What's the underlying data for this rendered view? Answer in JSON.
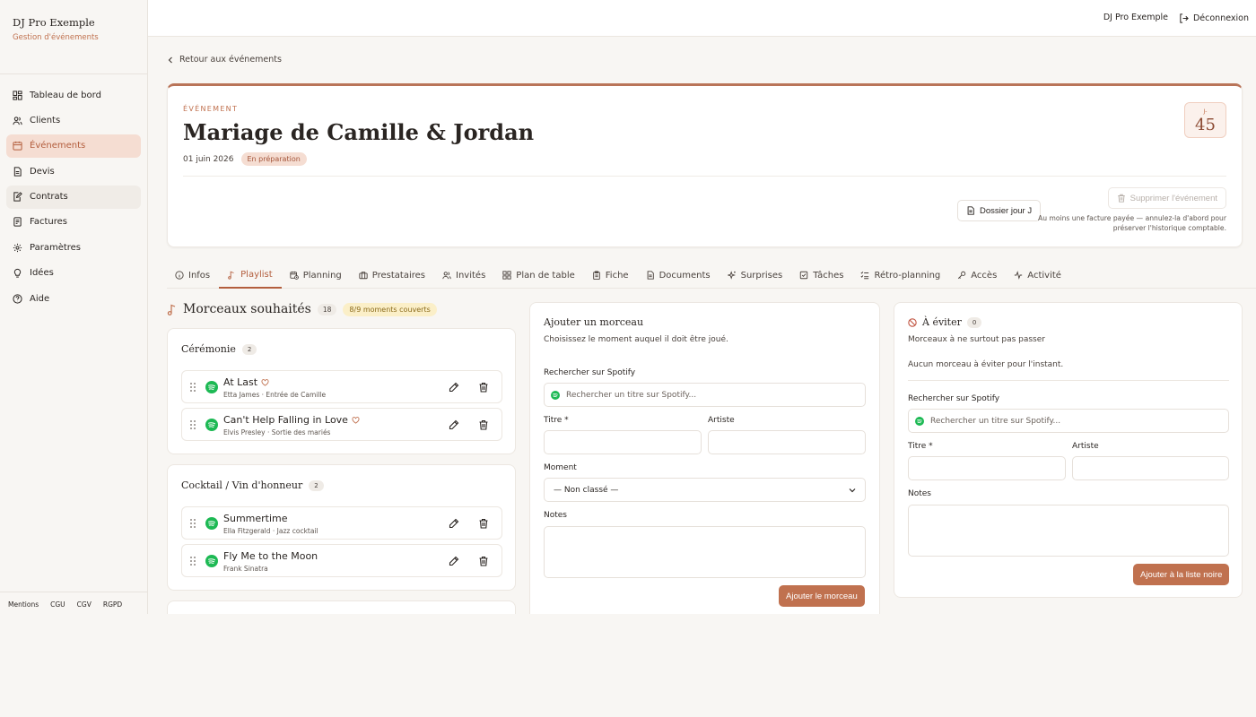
{
  "brand": {
    "name": "DJ Pro Exemple",
    "subtitle": "Gestion d'événements"
  },
  "nav": [
    {
      "label": "Tableau de bord",
      "icon": "dashboard-icon"
    },
    {
      "label": "Clients",
      "icon": "users-icon"
    },
    {
      "label": "Événements",
      "icon": "calendar-icon",
      "active": true
    },
    {
      "label": "Devis",
      "icon": "document-icon"
    },
    {
      "label": "Contrats",
      "icon": "contract-icon"
    },
    {
      "label": "Factures",
      "icon": "invoice-icon"
    },
    {
      "label": "Paramètres",
      "icon": "gear-icon"
    },
    {
      "label": "Idées",
      "icon": "lightbulb-icon"
    },
    {
      "label": "Aide",
      "icon": "help-icon"
    }
  ],
  "footer_links": [
    "Mentions",
    "CGU",
    "CGV",
    "RGPD"
  ],
  "topbar": {
    "user": "DJ Pro Exemple",
    "logout": "Déconnexion"
  },
  "back_link": "Retour aux événements",
  "event": {
    "kicker": "ÉVÉNEMENT",
    "title": "Mariage de Camille & Jordan",
    "date": "01 juin 2026",
    "status": "En préparation",
    "countdown_label": "J-",
    "countdown_value": "45",
    "dossier_button": "Dossier jour J",
    "delete_button": "Supprimer l'événement",
    "delete_note": "Au moins une facture payée — annulez-la d'abord pour préserver l'historique comptable."
  },
  "tabs": [
    {
      "label": "Infos",
      "icon": "info-icon"
    },
    {
      "label": "Playlist",
      "icon": "music-note-icon",
      "active": true
    },
    {
      "label": "Planning",
      "icon": "calendar-clock-icon"
    },
    {
      "label": "Prestataires",
      "icon": "briefcase-icon"
    },
    {
      "label": "Invités",
      "icon": "users-icon"
    },
    {
      "label": "Plan de table",
      "icon": "grid-icon"
    },
    {
      "label": "Fiche",
      "icon": "clipboard-icon"
    },
    {
      "label": "Documents",
      "icon": "document-icon"
    },
    {
      "label": "Surprises",
      "icon": "sparkles-icon"
    },
    {
      "label": "Tâches",
      "icon": "checkbox-icon"
    },
    {
      "label": "Rétro-planning",
      "icon": "list-checks-icon"
    },
    {
      "label": "Accès",
      "icon": "key-icon"
    },
    {
      "label": "Activité",
      "icon": "activity-icon"
    }
  ],
  "playlist": {
    "title": "Morceaux souhaités",
    "count": "18",
    "coverage": "8/9 moments couverts",
    "groups": [
      {
        "name": "Cérémonie",
        "count": "2",
        "songs": [
          {
            "title": "At Last",
            "subtitle": "Etta James · Entrée de Camille",
            "favorite": true
          },
          {
            "title": "Can't Help Falling in Love",
            "subtitle": "Elvis Presley · Sortie des mariés",
            "favorite": true
          }
        ]
      },
      {
        "name": "Cocktail / Vin d'honneur",
        "count": "2",
        "songs": [
          {
            "title": "Summertime",
            "subtitle": "Ella Fitzgerald · Jazz cocktail",
            "favorite": false
          },
          {
            "title": "Fly Me to the Moon",
            "subtitle": "Frank Sinatra",
            "favorite": false
          }
        ]
      }
    ]
  },
  "add_form": {
    "title": "Ajouter un morceau",
    "subtitle": "Choisissez le moment auquel il doit être joué.",
    "search_label": "Rechercher sur Spotify",
    "search_placeholder": "Rechercher un titre sur Spotify...",
    "title_label": "Titre *",
    "artist_label": "Artiste",
    "moment_label": "Moment",
    "moment_value": "— Non classé —",
    "notes_label": "Notes",
    "submit": "Ajouter le morceau"
  },
  "avoid_form": {
    "title": "À éviter",
    "count": "0",
    "subtitle": "Morceaux à ne surtout pas passer",
    "empty": "Aucun morceau à éviter pour l'instant.",
    "search_label": "Rechercher sur Spotify",
    "search_placeholder": "Rechercher un titre sur Spotify...",
    "title_label": "Titre *",
    "artist_label": "Artiste",
    "notes_label": "Notes",
    "submit": "Ajouter à la liste noire"
  },
  "colors": {
    "accent": "#c0714f",
    "active_bg": "#f5ddd2",
    "spotify": "#1db954",
    "coverage_bg": "#fbefc8"
  }
}
